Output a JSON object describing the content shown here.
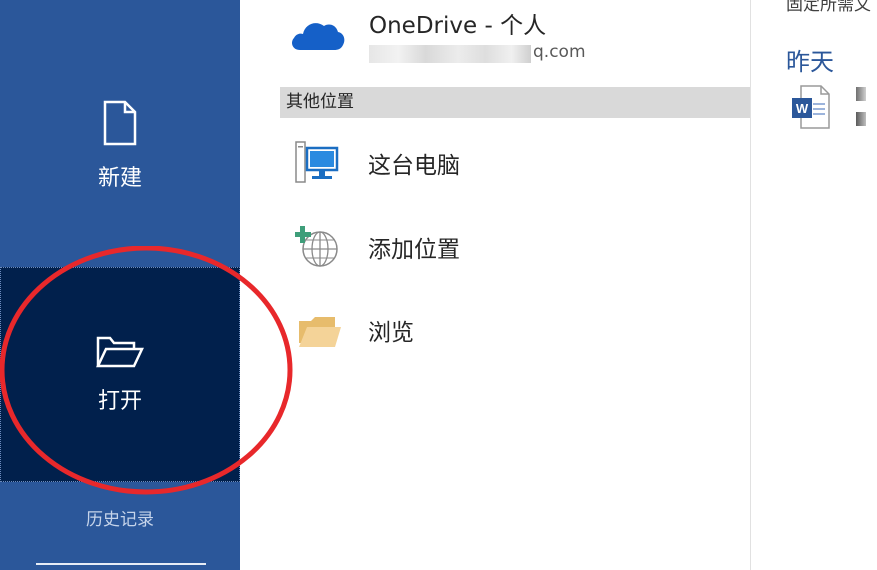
{
  "nav": {
    "new_label": "新建",
    "open_label": "打开",
    "history_label": "历史记录",
    "background": "#2b579a",
    "selected_background": "#01204c"
  },
  "places": {
    "onedrive": {
      "title": "OneDrive - 个人",
      "account_suffix": "q.com",
      "icon": "onedrive-cloud-icon"
    },
    "section_title": "其他位置",
    "items": [
      {
        "label": "这台电脑",
        "icon": "computer-icon"
      },
      {
        "label": "添加位置",
        "icon": "add-place-globe-icon"
      },
      {
        "label": "浏览",
        "icon": "folder-icon"
      }
    ]
  },
  "recent": {
    "tip_text": "固定所需文",
    "group_title": "昨天",
    "document_icon": "word-document-icon"
  },
  "annotation": {
    "color": "#e8282b",
    "shape": "ellipse"
  }
}
